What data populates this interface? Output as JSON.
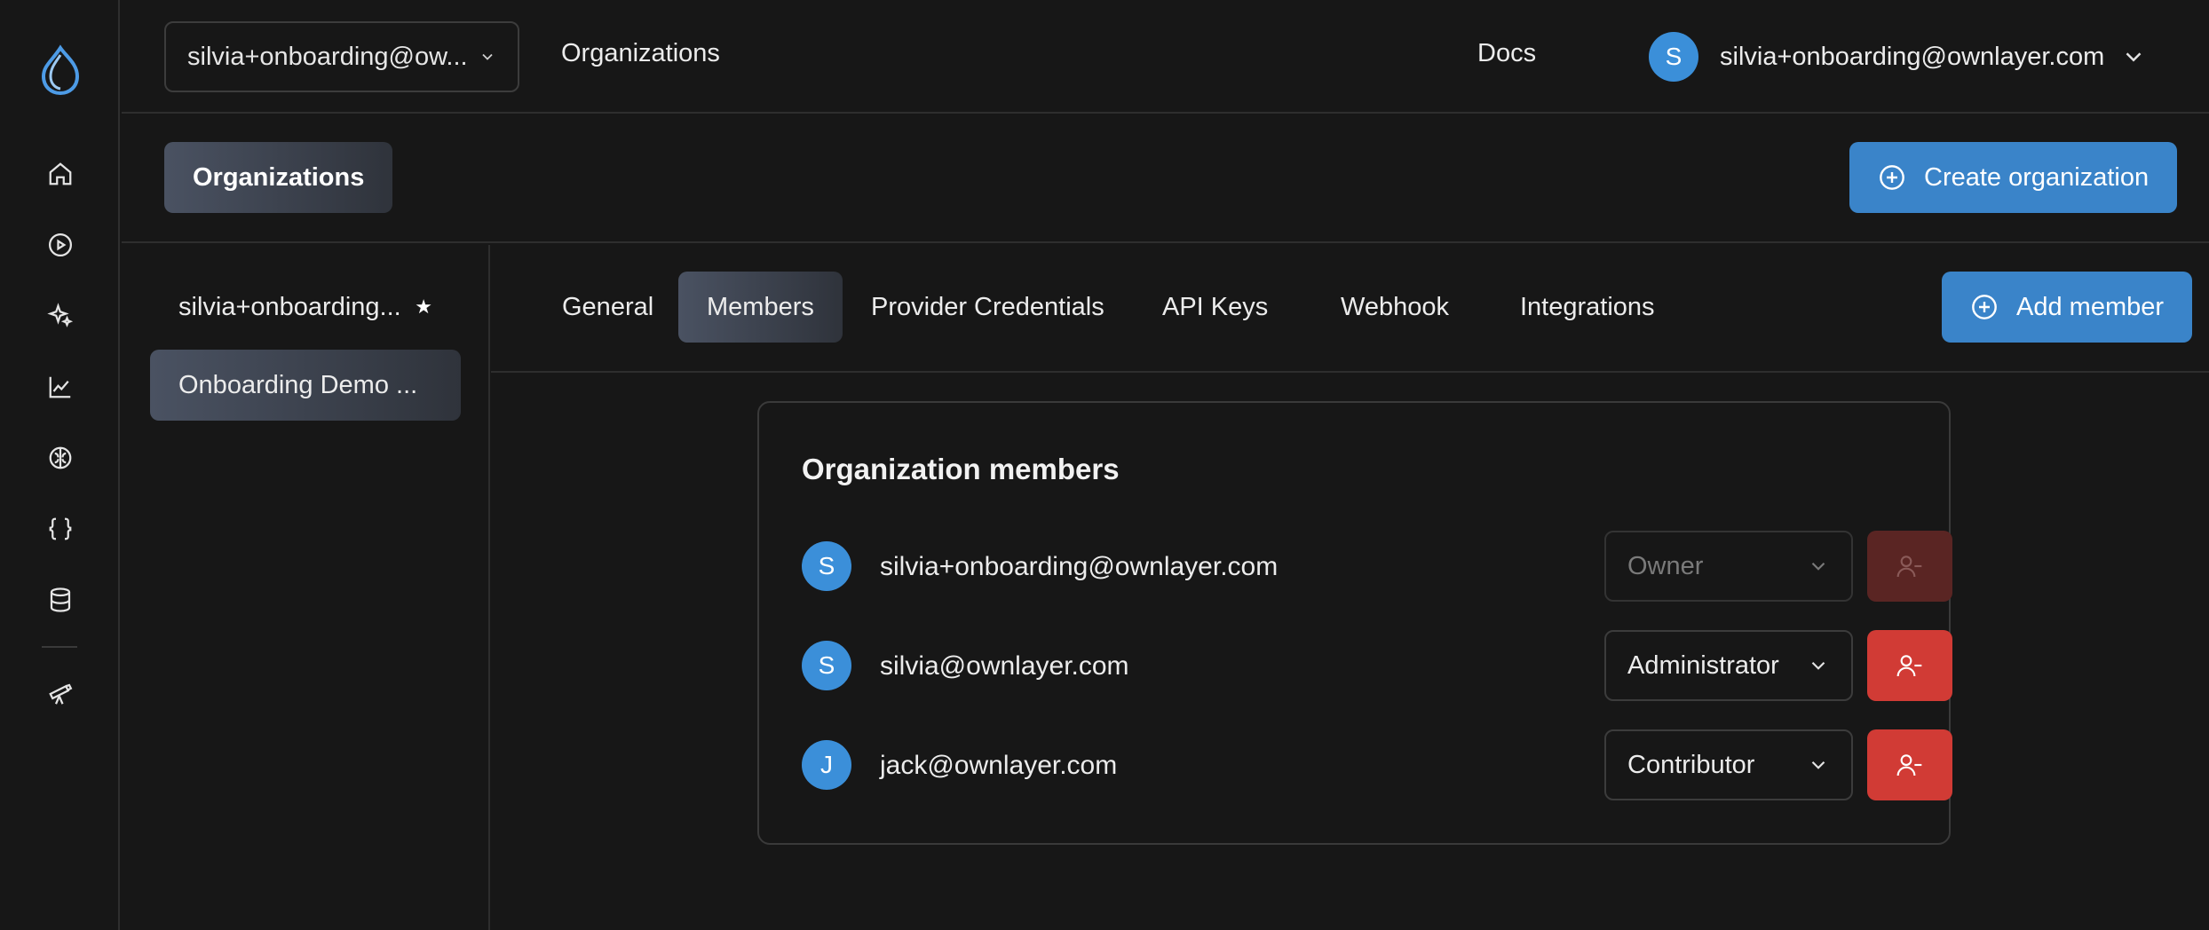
{
  "topbar": {
    "org_select_value": "silvia+onboarding@ow...",
    "page_title": "Organizations",
    "docs_label": "Docs",
    "user_initial": "S",
    "user_email": "silvia+onboarding@ownlayer.com"
  },
  "subheader": {
    "active_pill": "Organizations",
    "create_button": "Create organization"
  },
  "org_list": {
    "items": [
      {
        "label": "silvia+onboarding...",
        "starred": true
      },
      {
        "label": "Onboarding Demo ...",
        "selected": true
      }
    ],
    "star_glyph": "★"
  },
  "tabs": {
    "items": [
      "General",
      "Members",
      "Provider Credentials",
      "API Keys",
      "Webhook",
      "Integrations"
    ],
    "active": "Members",
    "add_member_button": "Add member"
  },
  "members": {
    "title": "Organization members",
    "rows": [
      {
        "initial": "S",
        "email": "silvia+onboarding@ownlayer.com",
        "role": "Owner",
        "disabled": true
      },
      {
        "initial": "S",
        "email": "silvia@ownlayer.com",
        "role": "Administrator",
        "disabled": false
      },
      {
        "initial": "J",
        "email": "jack@ownlayer.com",
        "role": "Contributor",
        "disabled": false
      }
    ]
  },
  "rail_icons": [
    "logo-icon",
    "home-icon",
    "play-icon",
    "sparkle-icon",
    "chart-icon",
    "brain-icon",
    "braces-icon",
    "database-icon",
    "telescope-icon"
  ],
  "colors": {
    "accent_blue": "#3a84c9",
    "avatar_blue": "#3b8fd9",
    "danger_red": "#d13b35",
    "danger_red_disabled": "#5a2523",
    "background": "#171717"
  }
}
